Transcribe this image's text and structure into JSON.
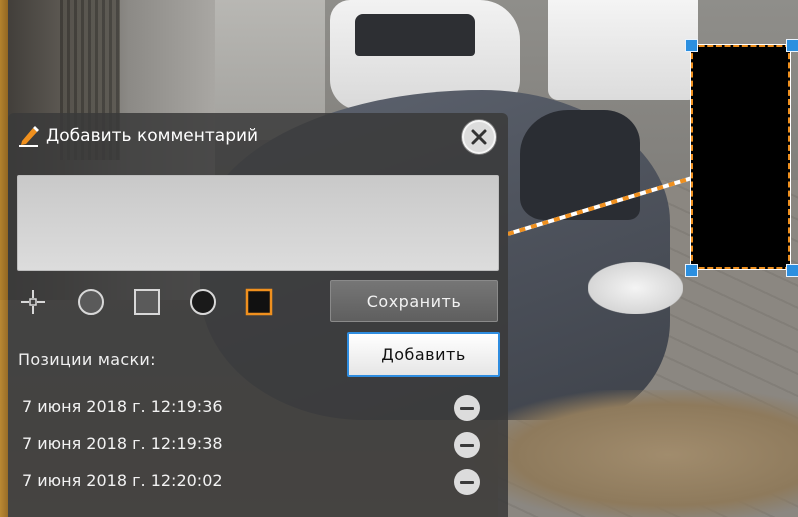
{
  "panel": {
    "title": "Добавить комментарий",
    "comment_value": "",
    "save_label": "Сохранить",
    "mask_positions_label": "Позиции маски:",
    "add_label": "Добавить",
    "positions": [
      "7 июня 2018 г. 12:19:36",
      "7 июня 2018 г. 12:19:38",
      "7 июня 2018 г. 12:20:02"
    ]
  },
  "tools": [
    {
      "icon": "crosshair-icon"
    },
    {
      "icon": "circle-outline-icon"
    },
    {
      "icon": "square-outline-icon"
    },
    {
      "icon": "circle-filled-icon"
    },
    {
      "icon": "square-filled-icon",
      "selected": true
    }
  ],
  "colors": {
    "accent": "#f0901e",
    "selection": "#2f8de0",
    "mask_fill": "#000000",
    "panel_bg": "#3a3a3a"
  }
}
